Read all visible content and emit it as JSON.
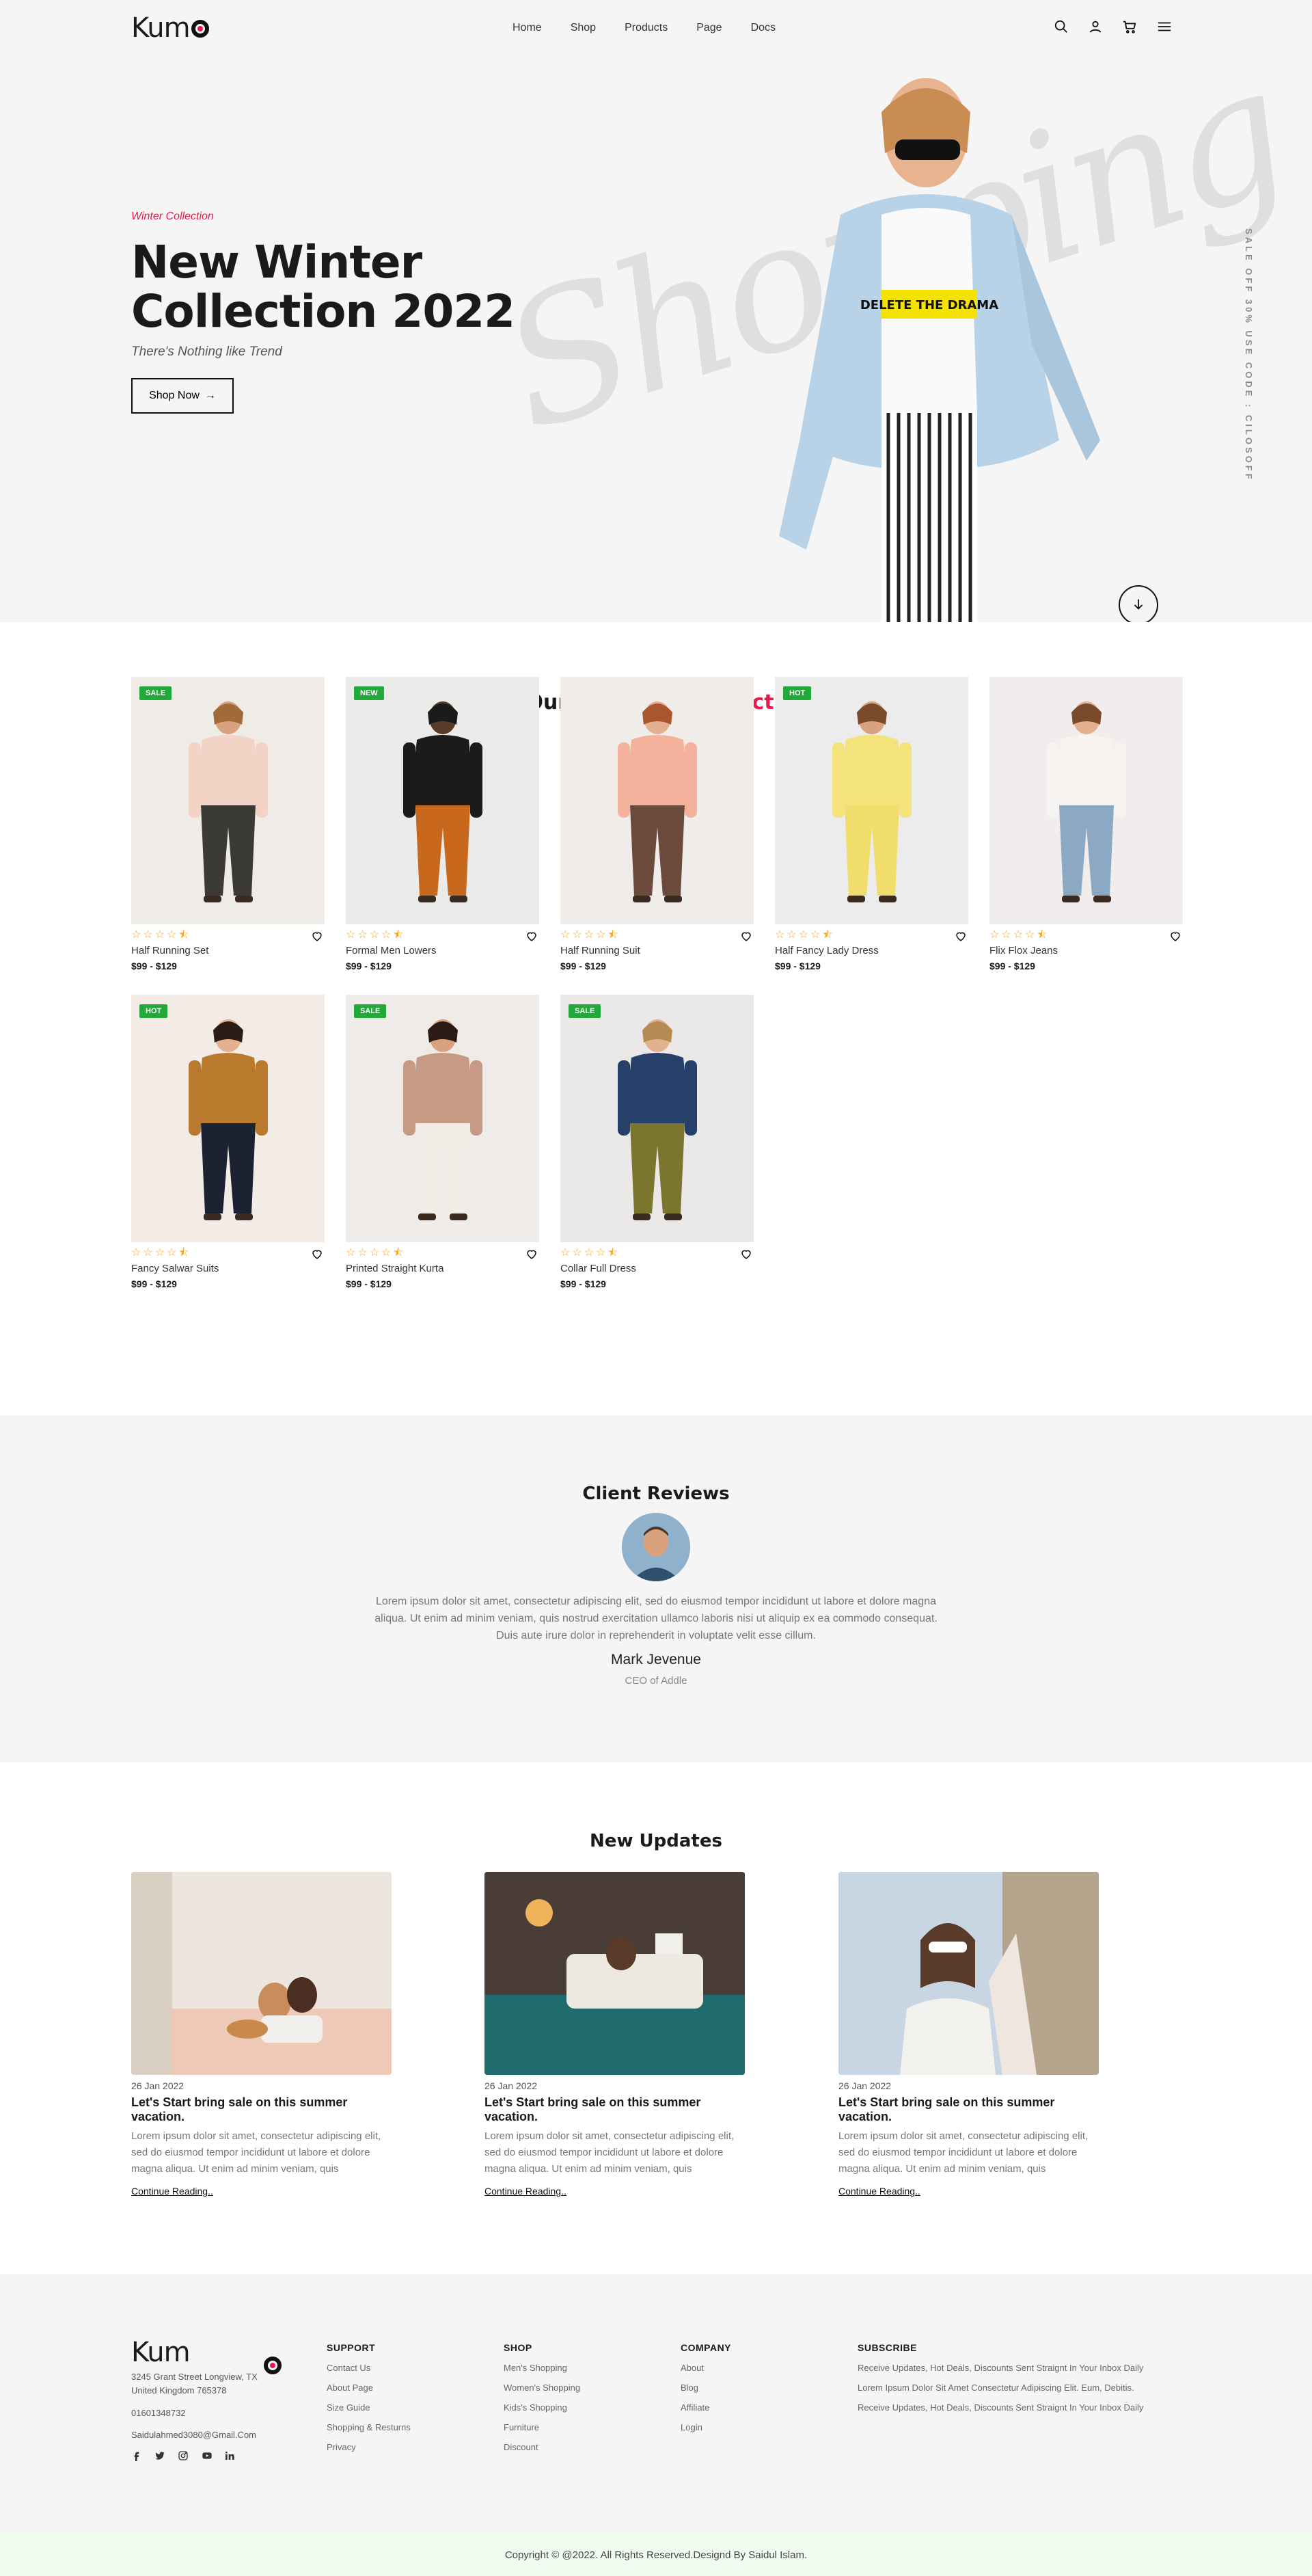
{
  "brand": {
    "name": "Kum",
    "accent": "#e8194d"
  },
  "nav": {
    "items": [
      "Home",
      "Shop",
      "Products",
      "Page",
      "Docs"
    ]
  },
  "header_icons": [
    "search-icon",
    "user-icon",
    "cart-icon",
    "menu-icon"
  ],
  "hero": {
    "eyebrow": "Winter Collection",
    "title": "New Winter Collection 2022",
    "tagline": "There's Nothing like Trend",
    "cta_label": "Shop Now",
    "script_text": "Shopping",
    "promo_vertical": "SALE OFF 30% USE CODE : CILOSOFF"
  },
  "trending": {
    "title_prefix": "Our Trending",
    "title_accent": "Products",
    "products": [
      {
        "name": "Half Running Set",
        "price": "$99 - $129",
        "badge": "SALE"
      },
      {
        "name": "Formal Men Lowers",
        "price": "$99 - $129",
        "badge": "NEW"
      },
      {
        "name": "Half Running Suit",
        "price": "$99 - $129",
        "badge": ""
      },
      {
        "name": "Half Fancy Lady Dress",
        "price": "$99 - $129",
        "badge": "HOT"
      },
      {
        "name": "Flix Flox Jeans",
        "price": "$99 - $129",
        "badge": ""
      },
      {
        "name": "Fancy Salwar Suits",
        "price": "$99 - $129",
        "badge": "HOT"
      },
      {
        "name": "Printed Straight Kurta",
        "price": "$99 - $129",
        "badge": "SALE"
      },
      {
        "name": "Collar Full Dress",
        "price": "$99 - $129",
        "badge": "SALE"
      }
    ],
    "rating": 4.5
  },
  "reviews": {
    "title": "Client Reviews",
    "text": "Lorem ipsum dolor sit amet, consectetur adipiscing elit, sed do eiusmod tempor incididunt ut labore et dolore magna aliqua. Ut enim ad minim veniam, quis nostrud exercitation ullamco laboris nisi ut aliquip ex ea commodo consequat. Duis aute irure dolor in reprehenderit in voluptate velit esse cillum.",
    "name": "Mark Jevenue",
    "role": "CEO of Addle"
  },
  "updates": {
    "title": "New Updates",
    "posts": [
      {
        "date": "26 Jan 2022",
        "title": "Let's Start bring sale on this summer vacation.",
        "excerpt": "Lorem ipsum dolor sit amet, consectetur adipiscing elit, sed do eiusmod tempor incididunt ut labore et dolore magna aliqua. Ut enim ad minim veniam, quis",
        "more": "Continue Reading.."
      },
      {
        "date": "26 Jan 2022",
        "title": "Let's Start bring sale on this summer vacation.",
        "excerpt": "Lorem ipsum dolor sit amet, consectetur adipiscing elit, sed do eiusmod tempor incididunt ut labore et dolore magna aliqua. Ut enim ad minim veniam, quis",
        "more": "Continue Reading.."
      },
      {
        "date": "26 Jan 2022",
        "title": "Let's Start bring sale on this summer vacation.",
        "excerpt": "Lorem ipsum dolor sit amet, consectetur adipiscing elit, sed do eiusmod tempor incididunt ut labore et dolore magna aliqua. Ut enim ad minim veniam, quis",
        "more": "Continue Reading.."
      }
    ]
  },
  "footer": {
    "address": "3245 Grant Street Longview, TX United Kingdom 765378",
    "phone": "01601348732",
    "email": "Saidulahmed3080@Gmail.Com",
    "social": [
      "facebook-icon",
      "twitter-icon",
      "instagram-icon",
      "youtube-icon",
      "linkedin-icon"
    ],
    "columns": [
      {
        "title": "SUPPORT",
        "links": [
          "Contact Us",
          "About Page",
          "Size Guide",
          "Shopping & Resturns",
          "Privacy"
        ]
      },
      {
        "title": "SHOP",
        "links": [
          "Men's Shopping",
          "Women's Shopping",
          "Kids's Shopping",
          "Furniture",
          "Discount"
        ]
      },
      {
        "title": "COMPANY",
        "links": [
          "About",
          "Blog",
          "Affiliate",
          "Login"
        ]
      },
      {
        "title": "SUBSCRIBE",
        "links": [
          "Receive Updates, Hot Deals, Discounts Sent Straignt In Your Inbox Daily",
          "Lorem Ipsum Dolor Sit Amet Consectetur Adipiscing Elit. Eum, Debitis.",
          "Receive Updates, Hot Deals, Discounts Sent Straignt In Your Inbox Daily"
        ]
      }
    ],
    "copyright": "Copyright © @2022. All Rights Reserved.Designd By Saidul Islam."
  }
}
